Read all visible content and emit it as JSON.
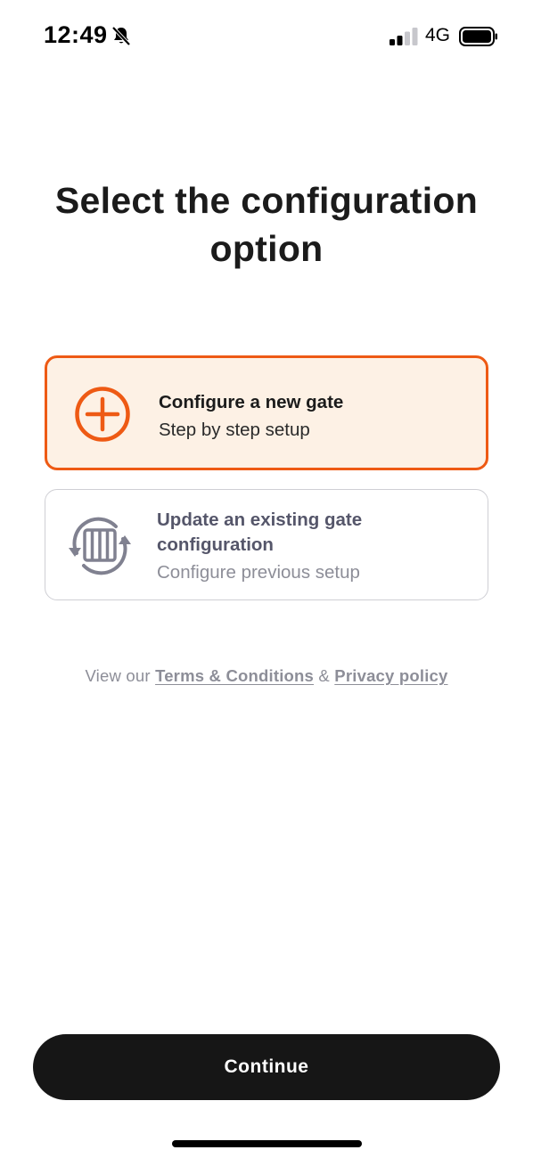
{
  "status_bar": {
    "time": "12:49",
    "network": "4G",
    "icons": [
      "bell-slash-icon",
      "signal-icon",
      "battery-icon"
    ]
  },
  "title": "Select the configuration option",
  "options": [
    {
      "title": "Configure a new gate",
      "subtitle": "Step by step setup",
      "icon": "plus-circle-icon",
      "selected": true
    },
    {
      "title": "Update an existing gate configuration",
      "subtitle": "Configure previous setup",
      "icon": "gate-sync-icon",
      "selected": false
    }
  ],
  "legal": {
    "prefix": "View our",
    "terms_link": "Terms & Conditions",
    "separator": "&",
    "privacy_link": "Privacy policy"
  },
  "continue_label": "Continue",
  "colors": {
    "accent": "#ee5a14",
    "selected_background": "#fdf1e5",
    "button_background": "#161616",
    "muted_text": "#8d8e98"
  }
}
